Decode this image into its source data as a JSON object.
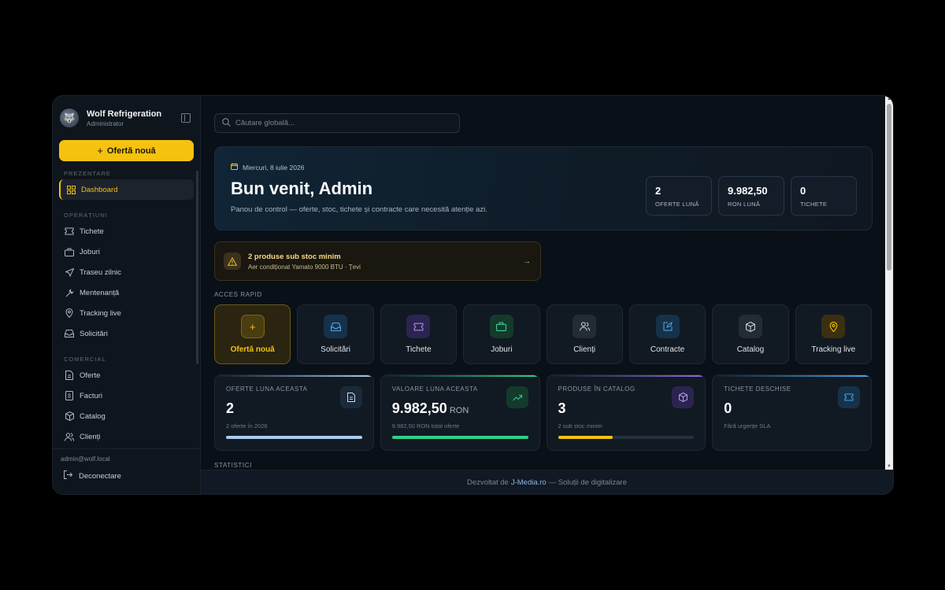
{
  "brand": {
    "name": "Wolf Refrigeration",
    "role": "Administrator"
  },
  "sidebar": {
    "cta_label": "Ofertă nouă",
    "sections": {
      "prezentare": "PREZENTARE",
      "operatiuni": "OPERAȚIUNI",
      "comercial": "COMERCIAL"
    },
    "items": [
      {
        "label": "Dashboard",
        "icon": "grid-icon"
      },
      {
        "label": "Tichete",
        "icon": "ticket-icon"
      },
      {
        "label": "Joburi",
        "icon": "briefcase-icon"
      },
      {
        "label": "Traseu zilnic",
        "icon": "send-icon"
      },
      {
        "label": "Mentenanță",
        "icon": "wrench-icon"
      },
      {
        "label": "Tracking live",
        "icon": "map-pin-icon"
      },
      {
        "label": "Solicitări",
        "icon": "inbox-icon"
      },
      {
        "label": "Oferte",
        "icon": "document-icon"
      },
      {
        "label": "Facturi",
        "icon": "invoice-icon"
      },
      {
        "label": "Catalog",
        "icon": "box-icon"
      },
      {
        "label": "Clienți",
        "icon": "users-icon"
      }
    ],
    "user_email": "admin@wolf.local",
    "logout_label": "Deconectare"
  },
  "search": {
    "placeholder": "Căutare globală..."
  },
  "hero": {
    "date": "Miercuri, 8 iulie 2026",
    "title": "Bun venit, Admin",
    "subtitle": "Panou de control — oferte, stoc, tichete și contracte care necesită atenție azi.",
    "stats": [
      {
        "value": "2",
        "label": "OFERTE LUNĂ"
      },
      {
        "value": "9.982,50",
        "label": "RON LUNĂ"
      },
      {
        "value": "0",
        "label": "TICHETE"
      }
    ]
  },
  "alert": {
    "title": "2 produse sub stoc minim",
    "detail": "Aer condiționat Yamato 9000 BTU · Țevi"
  },
  "quick_access": {
    "label": "ACCES RAPID",
    "items": [
      {
        "label": "Ofertă nouă",
        "icon": "plus-icon",
        "color": "#f5c20f"
      },
      {
        "label": "Solicitări",
        "icon": "inbox-icon",
        "color": "#5aa7e6"
      },
      {
        "label": "Tichete",
        "icon": "ticket-icon",
        "color": "#a58be8"
      },
      {
        "label": "Joburi",
        "icon": "briefcase-icon",
        "color": "#3ccf8e"
      },
      {
        "label": "Clienți",
        "icon": "users-icon",
        "color": "#c7cdd5"
      },
      {
        "label": "Contracte",
        "icon": "edit-document-icon",
        "color": "#5aa7e6"
      },
      {
        "label": "Catalog",
        "icon": "box-icon",
        "color": "#c7cdd5"
      },
      {
        "label": "Tracking live",
        "icon": "map-pin-icon",
        "color": "#f5c20f"
      }
    ]
  },
  "stat_cards": [
    {
      "label": "OFERTE LUNA ACEASTA",
      "value": "2",
      "unit": "",
      "sub": "2 oferte în 2026",
      "icon": "document-icon",
      "accent": "#a9c9ee",
      "progress": 1.0
    },
    {
      "label": "VALOARE LUNA ACEASTA",
      "value": "9.982,50",
      "unit": "RON",
      "sub": "9.982,50 RON total oferte",
      "icon": "trending-up-icon",
      "accent": "#2fcf8a",
      "progress": 1.0
    },
    {
      "label": "PRODUSE ÎN CATALOG",
      "value": "3",
      "unit": "",
      "sub": "2 sub stoc minim",
      "icon": "box-icon",
      "accent": "#f5c20f",
      "progress": 0.4
    },
    {
      "label": "TICHETE DESCHISE",
      "value": "0",
      "unit": "",
      "sub": "Fără urgențe SLA",
      "icon": "ticket-icon",
      "accent": "#4aa3e6",
      "progress": 0
    }
  ],
  "statistics_label": "STATISTICI",
  "footer": {
    "prefix": "Dezvoltat de",
    "link": "J-Media.ro",
    "suffix": "— Soluții de digitalizare"
  }
}
